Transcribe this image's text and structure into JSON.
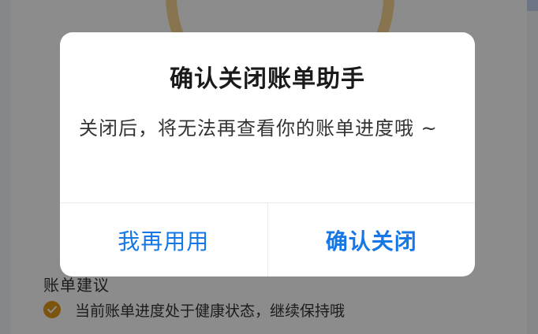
{
  "background": {
    "section_title": "账单建议",
    "tip_text": "当前账单进度处于健康状态，继续保持哦"
  },
  "dialog": {
    "title": "确认关闭账单助手",
    "message": "关闭后，将无法再查看你的账单进度哦 ~",
    "cancel_label": "我再用用",
    "confirm_label": "确认关闭"
  },
  "colors": {
    "accent": "#1677e6",
    "check": "#e39a19"
  }
}
